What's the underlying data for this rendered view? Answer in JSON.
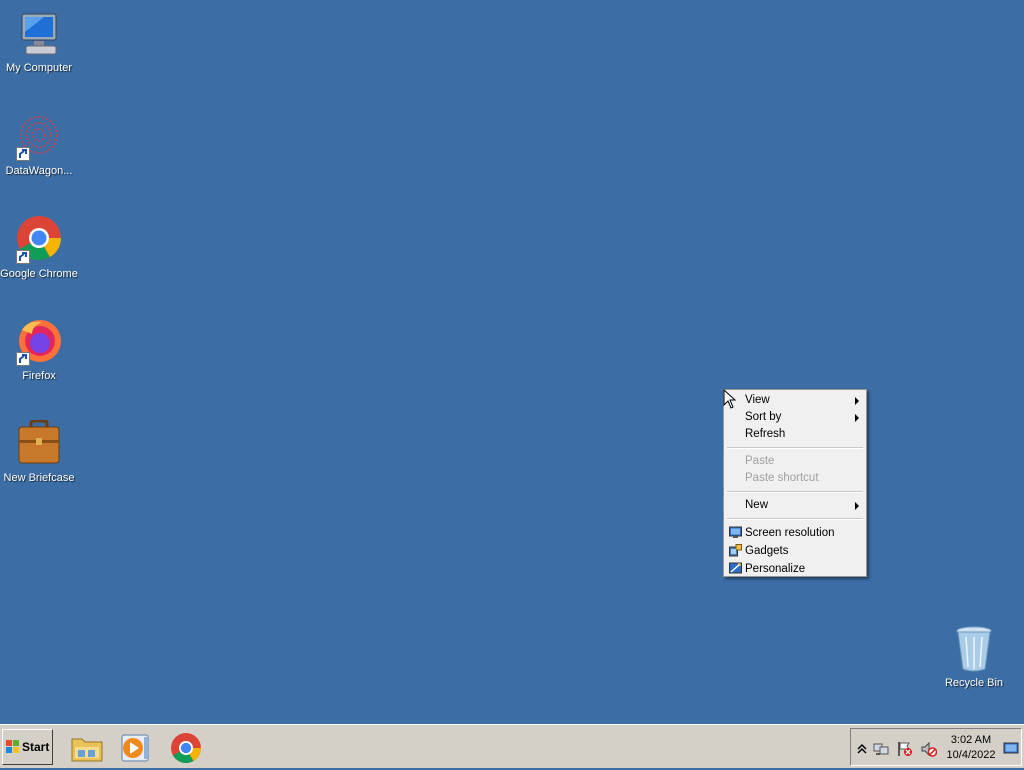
{
  "desktop": {
    "icons": [
      {
        "label": "My Computer",
        "icon": "computer-icon"
      },
      {
        "label": "DataWagon...",
        "icon": "datawagon-icon"
      },
      {
        "label": "Google Chrome",
        "icon": "chrome-icon"
      },
      {
        "label": "Firefox",
        "icon": "firefox-icon"
      },
      {
        "label": "New Briefcase",
        "icon": "briefcase-icon"
      },
      {
        "label": "Recycle Bin",
        "icon": "recycle-bin-icon"
      }
    ],
    "background_color": "#3c6ea5"
  },
  "context_menu": {
    "items": [
      {
        "label": "View",
        "submenu": true
      },
      {
        "label": "Sort by",
        "submenu": true
      },
      {
        "label": "Refresh"
      },
      {
        "label": "Paste",
        "disabled": true
      },
      {
        "label": "Paste shortcut",
        "disabled": true
      },
      {
        "label": "New",
        "submenu": true
      },
      {
        "label": "Screen resolution",
        "icon": "screen-resolution-icon"
      },
      {
        "label": "Gadgets",
        "icon": "gadgets-icon"
      },
      {
        "label": "Personalize",
        "icon": "personalize-icon"
      }
    ]
  },
  "taskbar": {
    "start_label": "Start",
    "pinned": [
      "file-explorer-icon",
      "media-player-icon",
      "chrome-icon"
    ],
    "clock": {
      "time": "3:02 AM",
      "date": "10/4/2022"
    }
  }
}
